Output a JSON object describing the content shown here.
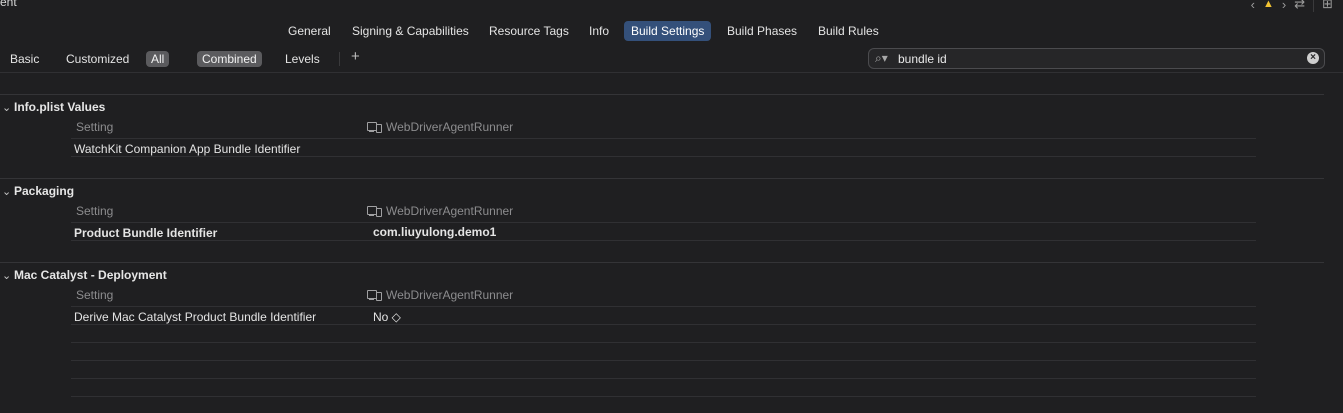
{
  "window": {
    "title_fragment": "ent"
  },
  "tabs": [
    {
      "label": "General",
      "active": false
    },
    {
      "label": "Signing & Capabilities",
      "active": false
    },
    {
      "label": "Resource Tags",
      "active": false
    },
    {
      "label": "Info",
      "active": false
    },
    {
      "label": "Build Settings",
      "active": true
    },
    {
      "label": "Build Phases",
      "active": false
    },
    {
      "label": "Build Rules",
      "active": false
    }
  ],
  "toolbar_icons": [
    "chevron-left-icon",
    "warning-icon",
    "chevron-right-icon",
    "swap-icon",
    "add-editor-icon"
  ],
  "filter": {
    "basic": "Basic",
    "customized": "Customized",
    "all": "All",
    "combined": "Combined",
    "levels": "Levels",
    "add": "+"
  },
  "search": {
    "value": "bundle id",
    "placeholder": ""
  },
  "sections": [
    {
      "title": "Info.plist Values",
      "header_setting": "Setting",
      "header_target": "WebDriverAgentRunner",
      "rows": [
        {
          "name": "WatchKit Companion App Bundle Identifier",
          "value": ""
        }
      ]
    },
    {
      "title": "Packaging",
      "header_setting": "Setting",
      "header_target": "WebDriverAgentRunner",
      "rows": [
        {
          "name": "Product Bundle Identifier",
          "value": "com.liuyulong.demo1"
        }
      ]
    },
    {
      "title": "Mac Catalyst - Deployment",
      "header_setting": "Setting",
      "header_target": "WebDriverAgentRunner",
      "rows": [
        {
          "name": "Derive Mac Catalyst Product Bundle Identifier",
          "value": "No ◇"
        }
      ]
    }
  ],
  "colors": {
    "background": "#1f1f21",
    "active_tab": "#34507a",
    "selected_filter": "#5b5b5e",
    "warning": "#f1c232"
  }
}
